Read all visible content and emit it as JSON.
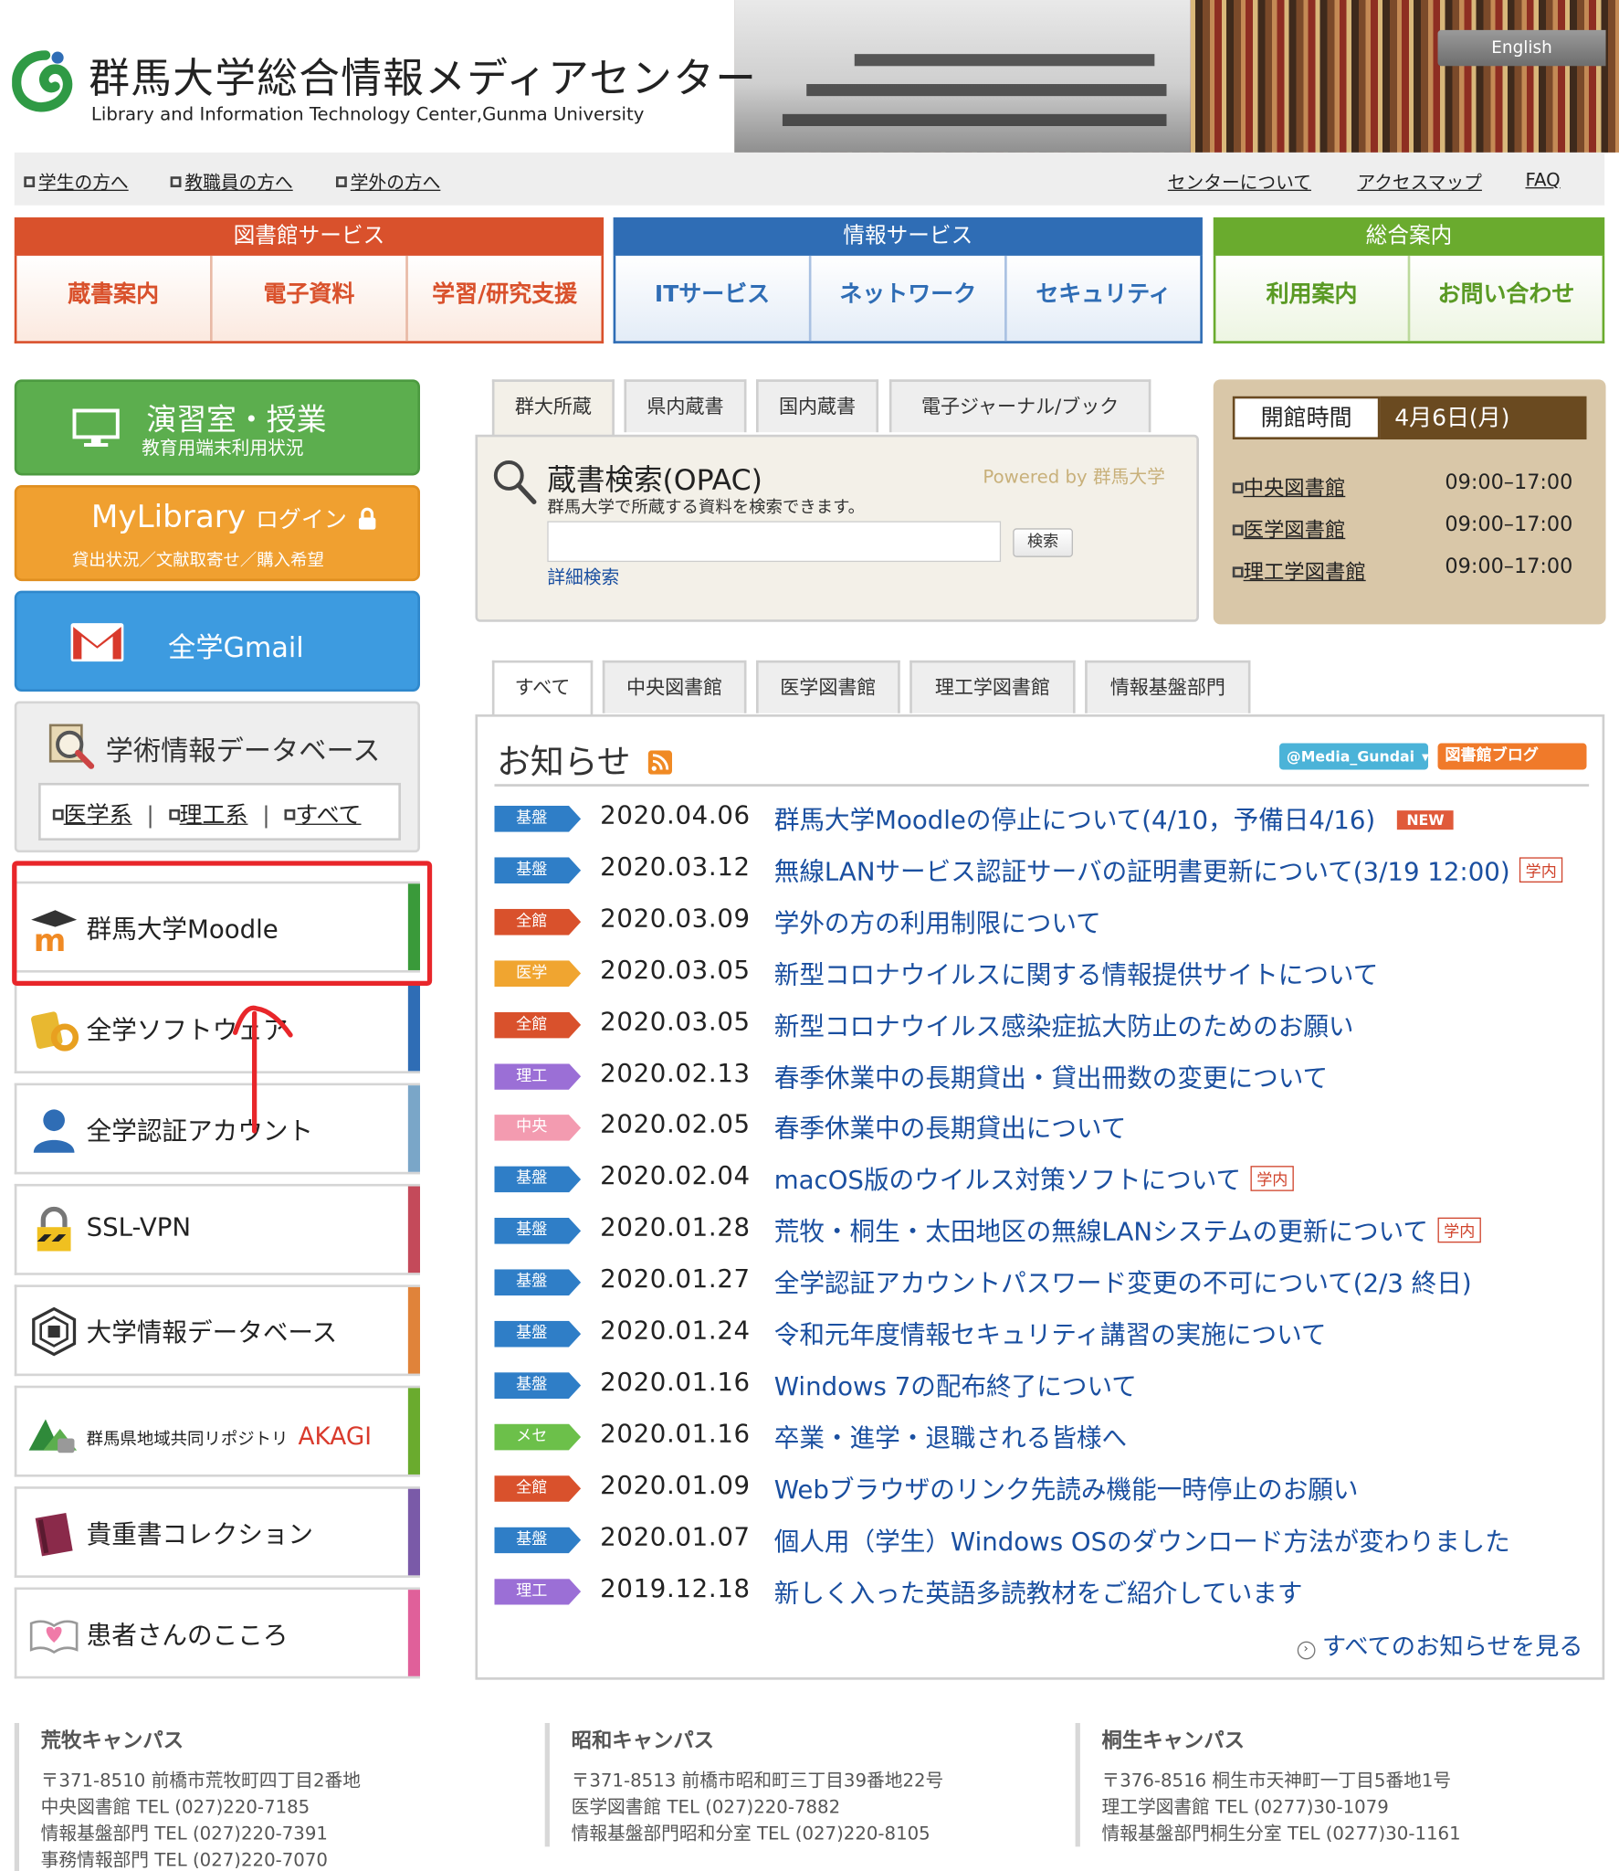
{
  "header": {
    "title": "群馬大学総合情報メディアセンター",
    "subtitle": "Library and Information Technology Center,Gunma University",
    "english_label": "English"
  },
  "topnav": {
    "left": [
      "学生の方へ",
      "教職員の方へ",
      "学外の方へ"
    ],
    "right": [
      "センターについて",
      "アクセスマップ",
      "FAQ"
    ]
  },
  "mega_menu": [
    {
      "caption": "図書館サービス",
      "color": "#d9512c",
      "items": [
        "蔵書案内",
        "電子資料",
        "学習/研究支援"
      ]
    },
    {
      "caption": "情報サービス",
      "color": "#2f6db5",
      "items": [
        "ITサービス",
        "ネットワーク",
        "セキュリティ"
      ]
    },
    {
      "caption": "総合案内",
      "color": "#6aab2e",
      "items": [
        "利用案内",
        "お問い合わせ"
      ]
    }
  ],
  "left": {
    "lab": {
      "title": "演習室・授業",
      "sub": "教育用端末利用状況"
    },
    "mylibrary": {
      "title": "MyLibrary",
      "login": "ログイン",
      "sub": "貸出状況／文献取寄せ／購入希望"
    },
    "gmail": {
      "title": "全学Gmail"
    },
    "db": {
      "title": "学術情報データベース",
      "links": [
        "医学系",
        "理工系",
        "すべて"
      ]
    },
    "links": [
      {
        "label": "群馬大学Moodle",
        "color": "#3a9a3a"
      },
      {
        "label": "全学ソフトウェア",
        "color": "#2f6db5"
      },
      {
        "label": "全学認証アカウント",
        "color": "#7aa6c8"
      },
      {
        "label": "SSL-VPN",
        "color": "#c44a5a"
      },
      {
        "label": "大学情報データベース",
        "color": "#e0833a"
      },
      {
        "label": "群馬県地域共同リポジトリ",
        "label2": "AKAGI",
        "color": "#6aab2e"
      },
      {
        "label": "貴重書コレクション",
        "color": "#7a5aa8"
      },
      {
        "label": "患者さんのこころ",
        "color": "#e0609a"
      }
    ]
  },
  "opac": {
    "tabs": [
      "群大所蔵",
      "県内蔵書",
      "国内蔵書",
      "電子ジャーナル/ブック"
    ],
    "title": "蔵書検索(OPAC)",
    "powered": "Powered by 群馬大学",
    "desc": "群馬大学で所蔵する資料を検索できます。",
    "search_value": "",
    "search_button": "検索",
    "advanced": "詳細検索"
  },
  "hours": {
    "label": "開館時間",
    "date": "4月6日(月)",
    "rows": [
      {
        "name": "中央図書館",
        "time": "09:00–17:00"
      },
      {
        "name": "医学図書館",
        "time": "09:00–17:00"
      },
      {
        "name": "理工学図書館",
        "time": "09:00–17:00"
      }
    ]
  },
  "news": {
    "tabs": [
      "すべて",
      "中央図書館",
      "医学図書館",
      "理工学図書館",
      "情報基盤部門"
    ],
    "title": "お知らせ",
    "twitter": "@Media_Gundai",
    "blog": "図書館ブログ",
    "new_label": "NEW",
    "inner_label": "学内",
    "more": "すべてのお知らせを見る",
    "items": [
      {
        "tag": "基盤",
        "color": "#2f7ec7",
        "date": "2020.04.06",
        "title": "群馬大学Moodleの停止について(4/10，予備日4/16)",
        "new": true,
        "inner": false
      },
      {
        "tag": "基盤",
        "color": "#2f7ec7",
        "date": "2020.03.12",
        "title": "無線LANサービス認証サーバの証明書更新について(3/19 12:00)",
        "new": false,
        "inner": true
      },
      {
        "tag": "全館",
        "color": "#d9512c",
        "date": "2020.03.09",
        "title": "学外の方の利用制限について",
        "new": false,
        "inner": false
      },
      {
        "tag": "医学",
        "color": "#f0a530",
        "date": "2020.03.05",
        "title": "新型コロナウイルスに関する情報提供サイトについて",
        "new": false,
        "inner": false
      },
      {
        "tag": "全館",
        "color": "#d9512c",
        "date": "2020.03.05",
        "title": "新型コロナウイルス感染症拡大防止のためのお願い",
        "new": false,
        "inner": false
      },
      {
        "tag": "理工",
        "color": "#9b6fd6",
        "date": "2020.02.13",
        "title": "春季休業中の長期貸出・貸出冊数の変更について",
        "new": false,
        "inner": false
      },
      {
        "tag": "中央",
        "color": "#f39bb0",
        "date": "2020.02.05",
        "title": "春季休業中の長期貸出について",
        "new": false,
        "inner": false
      },
      {
        "tag": "基盤",
        "color": "#2f7ec7",
        "date": "2020.02.04",
        "title": "macOS版のウイルス対策ソフトについて",
        "new": false,
        "inner": true
      },
      {
        "tag": "基盤",
        "color": "#2f7ec7",
        "date": "2020.01.28",
        "title": "荒牧・桐生・太田地区の無線LANシステムの更新について",
        "new": false,
        "inner": true
      },
      {
        "tag": "基盤",
        "color": "#2f7ec7",
        "date": "2020.01.27",
        "title": "全学認証アカウントパスワード変更の不可について(2/3 終日)",
        "new": false,
        "inner": false
      },
      {
        "tag": "基盤",
        "color": "#2f7ec7",
        "date": "2020.01.24",
        "title": "令和元年度情報セキュリティ講習の実施について",
        "new": false,
        "inner": false
      },
      {
        "tag": "基盤",
        "color": "#2f7ec7",
        "date": "2020.01.16",
        "title": "Windows 7の配布終了について",
        "new": false,
        "inner": false
      },
      {
        "tag": "メセ",
        "color": "#6cc04a",
        "date": "2020.01.16",
        "title": "卒業・進学・退職される皆様へ",
        "new": false,
        "inner": false
      },
      {
        "tag": "全館",
        "color": "#d9512c",
        "date": "2020.01.09",
        "title": "Webブラウザのリンク先読み機能一時停止のお願い",
        "new": false,
        "inner": false
      },
      {
        "tag": "基盤",
        "color": "#2f7ec7",
        "date": "2020.01.07",
        "title": "個人用（学生）Windows OSのダウンロード方法が変わりました",
        "new": false,
        "inner": false
      },
      {
        "tag": "理工",
        "color": "#9b6fd6",
        "date": "2019.12.18",
        "title": "新しく入った英語多読教材をご紹介しています",
        "new": false,
        "inner": false
      }
    ]
  },
  "footer": [
    {
      "campus": "荒牧キャンパス",
      "lines": [
        "〒371-8510 前橋市荒牧町四丁目2番地",
        "中央図書館 TEL (027)220-7185",
        "情報基盤部門 TEL (027)220-7391",
        "事務情報部門 TEL (027)220-7070"
      ]
    },
    {
      "campus": "昭和キャンパス",
      "lines": [
        "〒371-8513 前橋市昭和町三丁目39番地22号",
        "医学図書館 TEL (027)220-7882",
        "情報基盤部門昭和分室 TEL (027)220-8105"
      ]
    },
    {
      "campus": "桐生キャンパス",
      "lines": [
        "〒376-8516 桐生市天神町一丁目5番地1号",
        "理工学図書館 TEL (0277)30-1079",
        "情報基盤部門桐生分室 TEL (0277)30-1161"
      ]
    }
  ]
}
